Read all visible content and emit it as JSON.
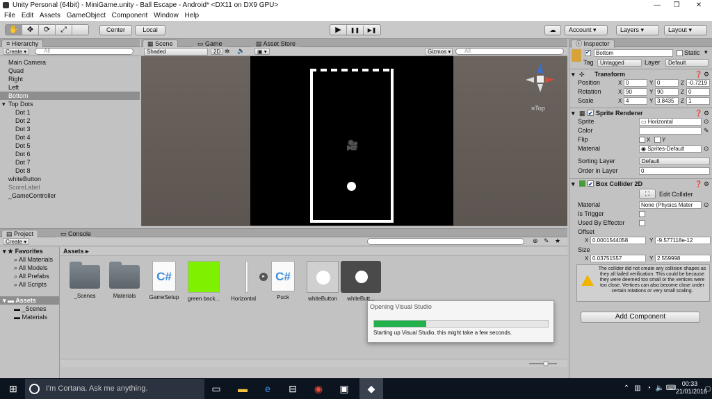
{
  "window": {
    "title": "Unity Personal (64bit) - MiniGame.unity - Ball Escape - Android* <DX11 on DX9 GPU>",
    "minimize_glyph": "—",
    "restore_glyph": "❐",
    "close_glyph": "✕"
  },
  "menu": [
    "File",
    "Edit",
    "Assets",
    "GameObject",
    "Component",
    "Window",
    "Help"
  ],
  "toolbar": {
    "pivot_label": "Center",
    "space_label": "Local",
    "play_glyph": "▶",
    "pause_glyph": "❚❚",
    "step_glyph": "▶❚",
    "account_label": "Account",
    "layers_label": "Layers",
    "layout_label": "Layout"
  },
  "hierarchy": {
    "tab_label": "Hierarchy",
    "create_label": "Create",
    "search_placeholder": "All",
    "items": [
      {
        "label": "Main Camera",
        "indent": 0,
        "state": "normal"
      },
      {
        "label": "Quad",
        "indent": 0,
        "state": "normal"
      },
      {
        "label": "Right",
        "indent": 0,
        "state": "normal"
      },
      {
        "label": "Left",
        "indent": 0,
        "state": "normal"
      },
      {
        "label": "Bottom",
        "indent": 0,
        "state": "selected"
      },
      {
        "label": "Top Dots",
        "indent": 0,
        "state": "expanded"
      },
      {
        "label": "Dot 1",
        "indent": 1,
        "state": "normal"
      },
      {
        "label": "Dot 2",
        "indent": 1,
        "state": "normal"
      },
      {
        "label": "Dot 3",
        "indent": 1,
        "state": "normal"
      },
      {
        "label": "Dot 4",
        "indent": 1,
        "state": "normal"
      },
      {
        "label": "Dot 5",
        "indent": 1,
        "state": "normal"
      },
      {
        "label": "Dot 6",
        "indent": 1,
        "state": "normal"
      },
      {
        "label": "Dot 7",
        "indent": 1,
        "state": "normal"
      },
      {
        "label": "Dot 8",
        "indent": 1,
        "state": "normal"
      },
      {
        "label": "whiteButton",
        "indent": 0,
        "state": "normal"
      },
      {
        "label": "ScoreLabel",
        "indent": 0,
        "state": "inactive"
      },
      {
        "label": "_GameController",
        "indent": 0,
        "state": "normal"
      }
    ]
  },
  "scene": {
    "tabs": [
      "Scene",
      "Game",
      "Asset Store"
    ],
    "shading_label": "Shaded",
    "mode_2d_label": "2D",
    "gizmos_label": "Gizmos",
    "search_placeholder": "All",
    "orientation_label": "Top"
  },
  "inspector": {
    "tab_label": "Inspector",
    "object_name": "Bottom",
    "static_label": "Static",
    "tag_label": "Tag",
    "tag_value": "Untagged",
    "layer_label": "Layer",
    "layer_value": "Default",
    "transform": {
      "title": "Transform",
      "position_label": "Position",
      "rotation_label": "Rotation",
      "scale_label": "Scale",
      "position": {
        "x": "0",
        "y": "0",
        "z": "-0.7219"
      },
      "rotation": {
        "x": "90",
        "y": "90",
        "z": "0"
      },
      "scale": {
        "x": "4",
        "y": "3.8435",
        "z": "1"
      }
    },
    "sprite_renderer": {
      "title": "Sprite Renderer",
      "sprite_label": "Sprite",
      "sprite_value": "Horizontal",
      "color_label": "Color",
      "flip_label": "Flip",
      "flip_x": "X",
      "flip_y": "Y",
      "material_label": "Material",
      "material_value": "Sprites-Default",
      "sorting_layer_label": "Sorting Layer",
      "sorting_layer_value": "Default",
      "order_label": "Order in Layer",
      "order_value": "0"
    },
    "box_collider": {
      "title": "Box Collider 2D",
      "edit_label": "Edit Collider",
      "material_label": "Material",
      "material_value": "None (Physics Mater",
      "is_trigger_label": "Is Trigger",
      "used_by_effector_label": "Used By Effector",
      "offset_label": "Offset",
      "offset": {
        "x": "0.0001544058",
        "y": "-9.577118e-12"
      },
      "size_label": "Size",
      "size": {
        "x": "0.03751557",
        "y": "2.559998"
      },
      "warning": "The collider did not create any collision shapes as they all failed verification. This could be because they were deemed too small or the vertices were too close. Vertices can also become close under certain rotations or very small scaling."
    },
    "add_component_label": "Add Component"
  },
  "project": {
    "tabs": [
      "Project",
      "Console"
    ],
    "create_label": "Create",
    "favorites_label": "Favorites",
    "favorites": [
      "All Materials",
      "All Models",
      "All Prefabs",
      "All Scripts"
    ],
    "assets_root_label": "Assets",
    "folders": [
      "_Scenes",
      "Materials"
    ],
    "breadcrumb": "Assets",
    "assets": [
      {
        "label": "_Scenes",
        "kind": "folder"
      },
      {
        "label": "Materials",
        "kind": "folder"
      },
      {
        "label": "GameSetup",
        "kind": "script"
      },
      {
        "label": "green back...",
        "kind": "green"
      },
      {
        "label": "Horizontal",
        "kind": "sprite"
      },
      {
        "label": "Puck",
        "kind": "script"
      },
      {
        "label": "whiteButton",
        "kind": "button-light"
      },
      {
        "label": "whiteButt...",
        "kind": "button-dark"
      }
    ]
  },
  "progress_dialog": {
    "title": "Opening Visual Studio",
    "message": "Starting up Visual Studio, this might take a few seconds.",
    "progress": 0.3,
    "bar_color": "#22b14c"
  },
  "taskbar": {
    "cortana_placeholder": "I'm Cortana. Ask me anything.",
    "time": "00:33",
    "date": "21/01/2016"
  }
}
